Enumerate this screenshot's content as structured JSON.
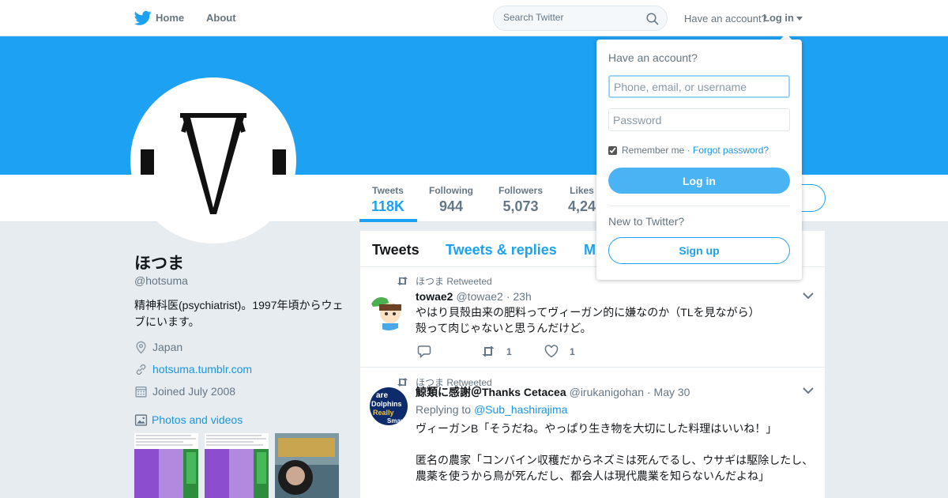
{
  "nav": {
    "logo_icon": "twitter-bird-icon",
    "home_label": "Home",
    "about_label": "About",
    "search_placeholder": "Search Twitter",
    "have_account": "Have an account?",
    "login_label": "Log in"
  },
  "colors": {
    "brand": "#1da1f2",
    "banner": "#1da1f2",
    "link": "#1b95e0"
  },
  "profile": {
    "name": "ほつま",
    "handle": "@hotsuma",
    "bio": "精神科医(psychiatrist)。1997年頃からウェブにいます。",
    "location": "Japan",
    "website": "hotsuma.tumblr.com",
    "joined": "Joined July 2008",
    "photos_label": "Photos and videos"
  },
  "stats": [
    {
      "label": "Tweets",
      "value": "118K"
    },
    {
      "label": "Following",
      "value": "944"
    },
    {
      "label": "Followers",
      "value": "5,073"
    },
    {
      "label": "Likes",
      "value": "4,24"
    }
  ],
  "tabs": {
    "tweets": "Tweets",
    "replies": "Tweets & replies",
    "media": "M"
  },
  "tweets": [
    {
      "retweeted_by": "ほつま Retweeted",
      "name": "towae2",
      "handle": "@towae2",
      "time": "· 23h",
      "text_line1": "やはり貝殻由来の肥料ってヴィーガン的に嫌なのか（TLを見ながら）",
      "text_line2": "殻って肉じゃないと思うんだけど。",
      "retweets": "1",
      "likes": "1"
    },
    {
      "retweeted_by": "ほつま Retweeted",
      "name": "鯨類に感謝＠Thanks Cetacea",
      "handle": "@irukanigohan",
      "time": "· May 30",
      "replying_prefix": "Replying to",
      "replying_to": "@Sub_hashirajima",
      "text_line1": "ヴィーガンB「そうだね。やっぱり生き物を大切にした料理はいいね！」",
      "text_line2": "匿名の農家「コンバイン収穫だからネズミは死んでるし、ウサギは駆除したし、",
      "text_line3": "農薬を使うから鳥が死んだし、都会人は現代農業を知らないんだよね」",
      "avatar_text": [
        "are",
        "Dolphins",
        "Really",
        "Smart"
      ]
    }
  ],
  "login_dropdown": {
    "title": "Have an account?",
    "username_placeholder": "Phone, email, or username",
    "password_placeholder": "Password",
    "remember_label": "Remember me ·",
    "forgot_label": "Forgot password?",
    "login_button": "Log in",
    "new_label": "New to Twitter?",
    "signup_button": "Sign up"
  }
}
